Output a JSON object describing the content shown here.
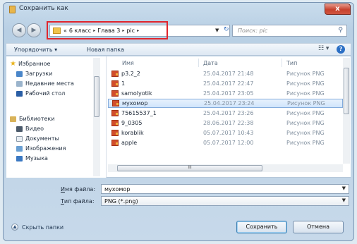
{
  "window": {
    "title": "Сохранить как",
    "close_label": "x"
  },
  "address": {
    "prefix": "«",
    "crumbs": [
      "6 класс",
      "Глава 3",
      "pic"
    ],
    "separator": "▸"
  },
  "search": {
    "placeholder": "Поиск: pic"
  },
  "toolbar": {
    "organize_label": "Упорядочить ▾",
    "new_folder_label": "Новая папка"
  },
  "nav_pane": {
    "favorites_label": "Избранное",
    "favorites": [
      "Загрузки",
      "Недавние места",
      "Рабочий стол"
    ],
    "libraries_label": "Библиотеки",
    "libraries": [
      "Видео",
      "Документы",
      "Изображения",
      "Музыка"
    ]
  },
  "file_list": {
    "columns": [
      "Имя",
      "Дата",
      "Тип"
    ],
    "rows": [
      {
        "name": "p3.2_2",
        "date": "25.04.2017 21:48",
        "type": "Рисунок PNG"
      },
      {
        "name": "1",
        "date": "25.04.2017 22:47",
        "type": "Рисунок PNG"
      },
      {
        "name": "samolyotik",
        "date": "25.04.2017 23:05",
        "type": "Рисунок PNG"
      },
      {
        "name": "мухомор",
        "date": "25.04.2017 23:24",
        "type": "Рисунок PNG",
        "selected": true
      },
      {
        "name": "75615537_1",
        "date": "25.04.2017 23:26",
        "type": "Рисунок PNG"
      },
      {
        "name": "9_0305",
        "date": "28.06.2017 22:38",
        "type": "Рисунок PNG"
      },
      {
        "name": "korablik",
        "date": "05.07.2017 10:43",
        "type": "Рисунок PNG"
      },
      {
        "name": "apple",
        "date": "05.07.2017 12:00",
        "type": "Рисунок PNG"
      }
    ],
    "hscroll_label": "III"
  },
  "form": {
    "filename_label_u": "И",
    "filename_label_rest": "мя файла:",
    "filename_value": "мухомор",
    "filetype_label_u": "Т",
    "filetype_label_rest": "ип файла:",
    "filetype_value": "PNG (*.png)"
  },
  "footer": {
    "hide_folders_label": "Скрыть папки",
    "save_label": "Сохранить",
    "cancel_label": "Отмена"
  },
  "colors": {
    "selection": "#cfe4fb",
    "address_highlight": "#e0252d",
    "close_button": "#c7412d"
  }
}
